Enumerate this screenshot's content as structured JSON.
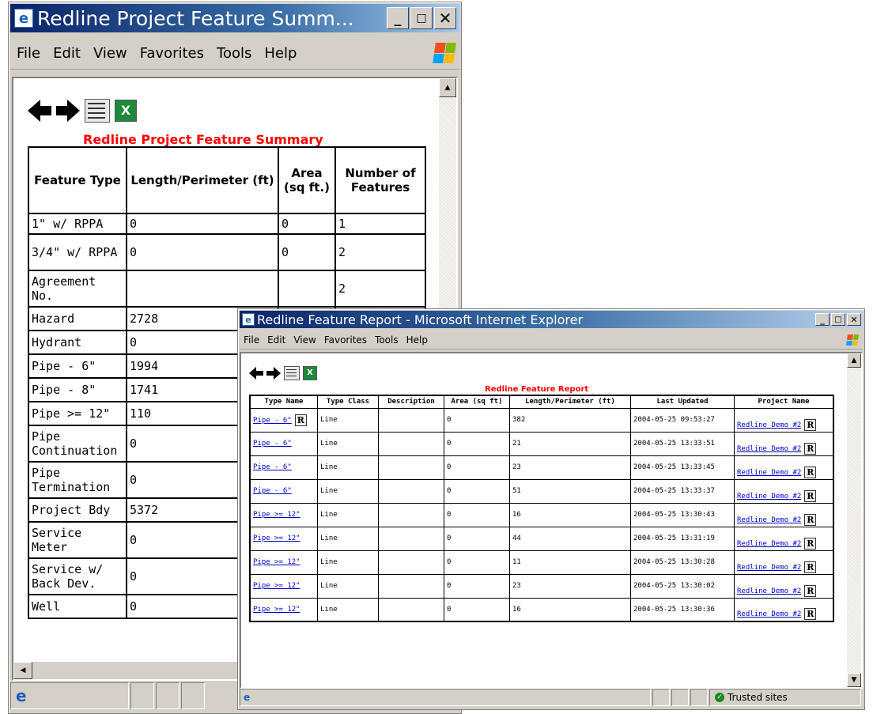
{
  "summary_window": {
    "title": "Redline Project Feature Summ...",
    "menu": [
      "File",
      "Edit",
      "View",
      "Favorites",
      "Tools",
      "Help"
    ],
    "report_title": "Redline Project Feature Summary",
    "columns": [
      "Feature Type",
      "Length/Perimeter (ft)",
      "Area (sq ft.)",
      "Number of Features"
    ],
    "rows": [
      {
        "type": "1\" w/ RPPA",
        "length": "0",
        "area": "0",
        "count": "1"
      },
      {
        "type": "3/4\" w/ RPPA",
        "length": "0",
        "area": "0",
        "count": "2"
      },
      {
        "type": "Agreement No.",
        "length": "",
        "area": "",
        "count": "2"
      },
      {
        "type": "Hazard",
        "length": "2728",
        "area": "",
        "count": ""
      },
      {
        "type": "Hydrant",
        "length": "0",
        "area": "",
        "count": ""
      },
      {
        "type": "Pipe - 6\"",
        "length": "1994",
        "area": "",
        "count": ""
      },
      {
        "type": "Pipe - 8\"",
        "length": "1741",
        "area": "",
        "count": ""
      },
      {
        "type": "Pipe >= 12\"",
        "length": "110",
        "area": "",
        "count": ""
      },
      {
        "type": "Pipe Continuation",
        "length": "0",
        "area": "",
        "count": ""
      },
      {
        "type": "Pipe Termination",
        "length": "0",
        "area": "",
        "count": ""
      },
      {
        "type": "Project Bdy",
        "length": "5372",
        "area": "",
        "count": ""
      },
      {
        "type": "Service Meter",
        "length": "0",
        "area": "",
        "count": ""
      },
      {
        "type": "Service w/ Back Dev.",
        "length": "0",
        "area": "",
        "count": ""
      },
      {
        "type": "Well",
        "length": "0",
        "area": "",
        "count": ""
      }
    ]
  },
  "report_window": {
    "title": "Redline Feature Report - Microsoft Internet Explorer",
    "menu": [
      "File",
      "Edit",
      "View",
      "Favorites",
      "Tools",
      "Help"
    ],
    "report_title": "Redline Feature Report",
    "columns": [
      "Type Name",
      "Type Class",
      "Description",
      "Area (sq ft)",
      "Length/Perimeter (ft)",
      "Last Updated",
      "Project Name"
    ],
    "rows": [
      {
        "name": "Pipe - 6\"",
        "cls": "Line",
        "desc": "",
        "area": "0",
        "length": "382",
        "updated": "2004-05-25 09:53:27",
        "project": "Redline Demo #2"
      },
      {
        "name": "Pipe - 6\"",
        "cls": "Line",
        "desc": "",
        "area": "0",
        "length": "21",
        "updated": "2004-05-25 13:33:51",
        "project": "Redline Demo #2"
      },
      {
        "name": "Pipe - 6\"",
        "cls": "Line",
        "desc": "",
        "area": "0",
        "length": "23",
        "updated": "2004-05-25 13:33:45",
        "project": "Redline Demo #2"
      },
      {
        "name": "Pipe - 6\"",
        "cls": "Line",
        "desc": "",
        "area": "0",
        "length": "51",
        "updated": "2004-05-25 13:33:37",
        "project": "Redline Demo #2"
      },
      {
        "name": "Pipe >= 12\"",
        "cls": "Line",
        "desc": "",
        "area": "0",
        "length": "16",
        "updated": "2004-05-25 13:30:43",
        "project": "Redline Demo #2"
      },
      {
        "name": "Pipe >= 12\"",
        "cls": "Line",
        "desc": "",
        "area": "0",
        "length": "44",
        "updated": "2004-05-25 13:31:19",
        "project": "Redline Demo #2"
      },
      {
        "name": "Pipe >= 12\"",
        "cls": "Line",
        "desc": "",
        "area": "0",
        "length": "11",
        "updated": "2004-05-25 13:30:28",
        "project": "Redline Demo #2"
      },
      {
        "name": "Pipe >= 12\"",
        "cls": "Line",
        "desc": "",
        "area": "0",
        "length": "23",
        "updated": "2004-05-25 13:30:02",
        "project": "Redline Demo #2"
      },
      {
        "name": "Pipe >= 12\"",
        "cls": "Line",
        "desc": "",
        "area": "0",
        "length": "16",
        "updated": "2004-05-25 13:30:36",
        "project": "Redline Demo #2"
      }
    ],
    "status_text": "Trusted sites"
  },
  "colors": {
    "title_red": "#ff0000",
    "link_blue": "#0000cc",
    "titlebar": "#0a246a"
  },
  "icons": [
    "ie-icon",
    "back-arrow-icon",
    "forward-arrow-icon",
    "table-view-icon",
    "excel-export-icon",
    "report-r-icon",
    "windows-logo-icon",
    "trusted-sites-icon"
  ]
}
